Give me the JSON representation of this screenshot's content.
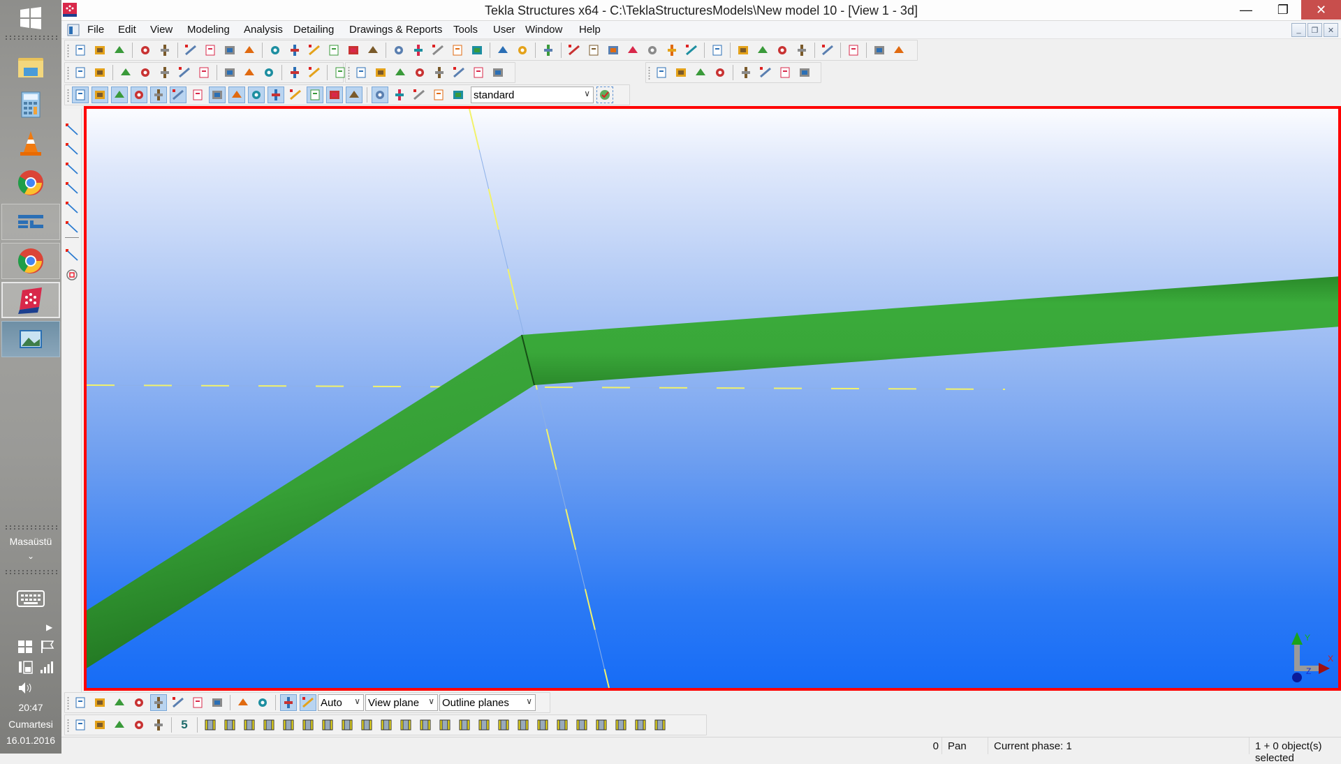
{
  "window": {
    "title": "Tekla Structures x64 - C:\\TeklaStructuresModels\\New model 10  - [View 1 - 3d]",
    "minimize": "—",
    "restore": "❐",
    "close": "✕"
  },
  "menu": {
    "items": [
      "File",
      "Edit",
      "View",
      "Modeling",
      "Analysis",
      "Detailing",
      "Drawings & Reports",
      "Tools",
      "User",
      "Window",
      "Help"
    ],
    "mdi_minimize": "_",
    "mdi_restore": "❐",
    "mdi_close": "✕"
  },
  "toolbars": {
    "standard_icons": [
      "new-icon",
      "open-icon",
      "save-icon",
      "undo-icon",
      "redo-icon",
      "copy-icon",
      "copy-special-icon",
      "print-icon",
      "report-icon",
      "view-properties-icon",
      "view-list-icon",
      "document-manager-icon",
      "cut-icon",
      "select-all-icon",
      "part-color-icon",
      "part-copy-icon",
      "part-mirror-icon",
      "part-filter-icon",
      "move-icon",
      "move-special-icon",
      "numbering-icon",
      "numbering-modified-icon",
      "help-icon",
      "dimension-parallel-icon",
      "dimension-perpendicular-icon",
      "dimension-free-icon",
      "angle-icon",
      "arc-icon",
      "grid-icon",
      "point-icon",
      "clash-check-icon",
      "clash-list-icon",
      "tasks-icon",
      "schedule-icon",
      "organizer-icon",
      "tekla-warehouse-icon",
      "applications-icon",
      "import-icon",
      "export-icon"
    ],
    "components_icons": [
      "catalog-icon",
      "component-copy-icon",
      "bolt-icon",
      "weld-icon",
      "beam-icon",
      "column-icon",
      "polybeam-icon",
      "curved-beam-icon",
      "plate-icon",
      "cut-part-icon",
      "fitting-icon",
      "reinforcement-mesh-icon",
      "grid-lines-icon",
      "pour-break-icon"
    ],
    "concrete_icons": [
      "concrete-column-icon",
      "concrete-beam-icon",
      "concrete-polybeam-icon",
      "concrete-curved-icon",
      "concrete-slab-icon",
      "concrete-pad-icon",
      "concrete-strip-icon",
      "concrete-item-icon"
    ],
    "inquire_icons": [
      "find-icon",
      "profile-icon",
      "settings-icon",
      "surface-icon",
      "cut-line-icon",
      "line-cut-icon",
      "polygon-cut-icon",
      "object-cut-icon"
    ],
    "selection_icons": [
      "select-all-objects-icon",
      "select-parts-icon",
      "select-surfaces-icon",
      "select-welds-icon",
      "select-grids-icon",
      "select-grid-lines-icon",
      "select-cuts-icon",
      "select-points-icon",
      "select-reinforcement-icon",
      "select-views-icon",
      "select-components-icon",
      "select-bolt-groups-icon",
      "select-bolts-icon",
      "select-loads-icon",
      "select-assemblies-icon",
      "select-objects-in-assembly-icon",
      "select-assembly-top-icon",
      "select-assembly-down-icon",
      "select-components-in-components-icon",
      "select-all-in-view-icon"
    ],
    "selection_filter": "standard",
    "selection_filter_button": "filter-settings-icon"
  },
  "snap_toolbar": {
    "icons": [
      "snap-reference-lines-icon",
      "snap-geometry-lines-icon",
      "snap-nearest-icon",
      "snap-midpoint-icon",
      "snap-intersection-icon",
      "snap-perpendicular-icon",
      "snap-line-extension-icon",
      "snap-any-position-icon",
      "snap-lines-icon",
      "snap-free-icon",
      "snap-override-icon",
      "snap-grid-icon"
    ],
    "depth": "Auto",
    "plane": "View plane",
    "planes_display": "Outline planes"
  },
  "steel_toolbar": {
    "icons": [
      "create-grid-icon",
      "applications-components-icon",
      "find-component-icon",
      "previous-icon",
      "next-icon",
      "defaults-icon",
      "bracing-icon",
      "end-plate-icon",
      "base-plate-icon",
      "clip-angle-icon",
      "channel-icon",
      "shear-plate-icon",
      "column-splice-icon",
      "haunch-icon",
      "stiffener-icon",
      "tube-gusset-icon",
      "connection-beam-icon",
      "connection-two-sided-icon",
      "connection-three-sided-icon",
      "web-stiffener-icon",
      "column-base-icon",
      "cap-plate-icon",
      "anchor-bolt-icon",
      "stair-icon",
      "joist-icon",
      "beam-splice-icon",
      "brace-gusset-icon",
      "moment-connection-icon",
      "end-cap-icon",
      "lifting-insert-icon"
    ],
    "default_count": "5"
  },
  "vertical_toolbar": {
    "icons": [
      "line-icon",
      "polyline-icon",
      "parallel-line-icon",
      "perpendicular-icon",
      "intersection-icon",
      "point-on-face-icon",
      "divide-line-icon",
      "circle-center-icon"
    ]
  },
  "viewport": {
    "name": "View 1 - 3d",
    "axes": {
      "x": "X",
      "y": "Y",
      "z": "Z"
    },
    "colors": {
      "beam": "#3aa63a",
      "beam_shadow": "#1f6b1f",
      "grid_line": "#f2f26a",
      "frame": "#ff0000"
    }
  },
  "statusbar": {
    "value": "0",
    "mode": "Pan",
    "phase": "Current phase: 1",
    "selection": "1 + 0 object(s) selected"
  },
  "taskbar": {
    "apps": [
      "start-button",
      "file-explorer",
      "calculator",
      "vlc-media-player",
      "google-chrome",
      "tekla-app",
      "google-chrome-2",
      "tekla-structures",
      "photos"
    ],
    "desktop_label": "Masaüstü",
    "desktop_chevron": "⌄",
    "time": "20:47",
    "day": "Cumartesi",
    "date": "16.01.2016"
  }
}
